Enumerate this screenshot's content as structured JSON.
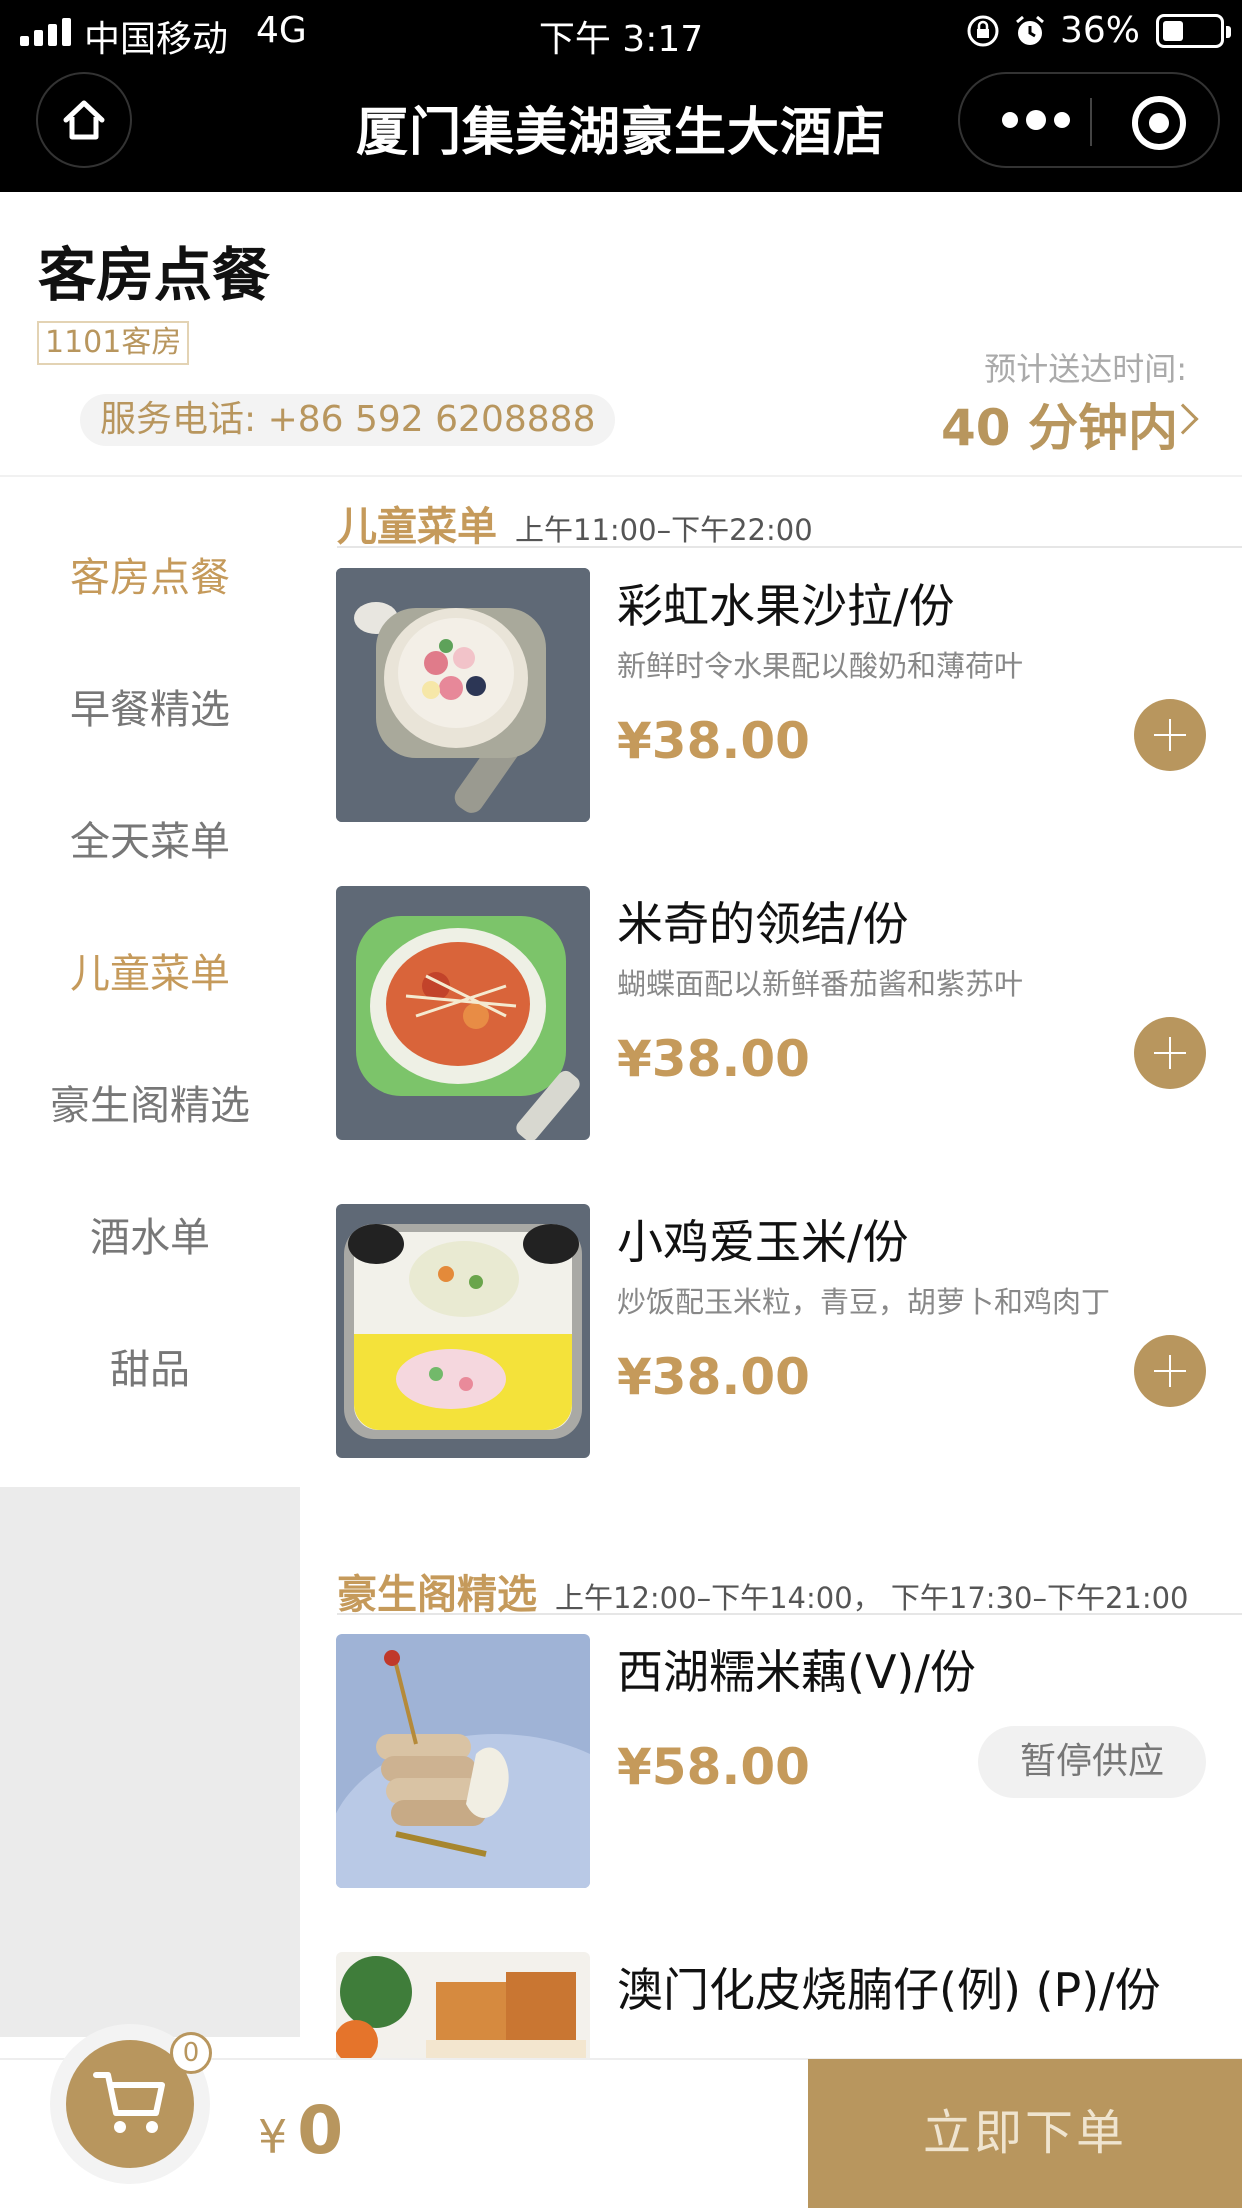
{
  "status_bar": {
    "carrier": "中国移动",
    "network": "4G",
    "time": "下午 3:17",
    "battery": "36%"
  },
  "nav": {
    "title": "厦门集美湖豪生大酒店"
  },
  "header": {
    "title": "客房点餐",
    "room": "1101客房",
    "phone": "服务电话:  +86 592 6208888",
    "eta_label": "预计送达时间:",
    "eta_value": "40 分钟内"
  },
  "sidebar": {
    "items": [
      {
        "label": "客房点餐",
        "active": true
      },
      {
        "label": "早餐精选",
        "active": false
      },
      {
        "label": "全天菜单",
        "active": false
      },
      {
        "label": "儿童菜单",
        "active": true
      },
      {
        "label": "豪生阁精选",
        "active": false
      },
      {
        "label": "酒水单",
        "active": false
      },
      {
        "label": "甜品",
        "active": false
      }
    ]
  },
  "sections": [
    {
      "title": "儿童菜单",
      "time": "上午11:00–下午22:00",
      "items": [
        {
          "name": "彩虹水果沙拉/份",
          "desc": "新鲜时令水果配以酸奶和薄荷叶",
          "price": "¥38.00",
          "action": "add"
        },
        {
          "name": "米奇的领结/份",
          "desc": "蝴蝶面配以新鲜番茄酱和紫苏叶",
          "price": "¥38.00",
          "action": "add"
        },
        {
          "name": "小鸡爱玉米/份",
          "desc": "炒饭配玉米粒，青豆，胡萝卜和鸡肉丁",
          "price": "¥38.00",
          "action": "add"
        }
      ]
    },
    {
      "title": "豪生阁精选",
      "time": "上午12:00–下午14:00， 下午17:30–下午21:00",
      "items": [
        {
          "name": "西湖糯米藕(V)/份",
          "price": "¥58.00",
          "status": "暂停供应"
        },
        {
          "name": "澳门化皮烧腩仔(例) (P)/份"
        }
      ]
    }
  ],
  "cart": {
    "count": "0",
    "currency": "¥",
    "total": "0",
    "order_label": "立即下单"
  },
  "colors": {
    "accent": "#b8965e",
    "accent_text": "#c59a5b",
    "nav_bg": "#000000",
    "sidebar_bg": "#ebebeb"
  },
  "icons": [
    "signal-icon",
    "lock-rotation-icon",
    "alarm-icon",
    "battery-icon",
    "home-icon",
    "more-dots-icon",
    "target-icon",
    "chevron-right-icon",
    "plus-icon",
    "cart-icon"
  ]
}
